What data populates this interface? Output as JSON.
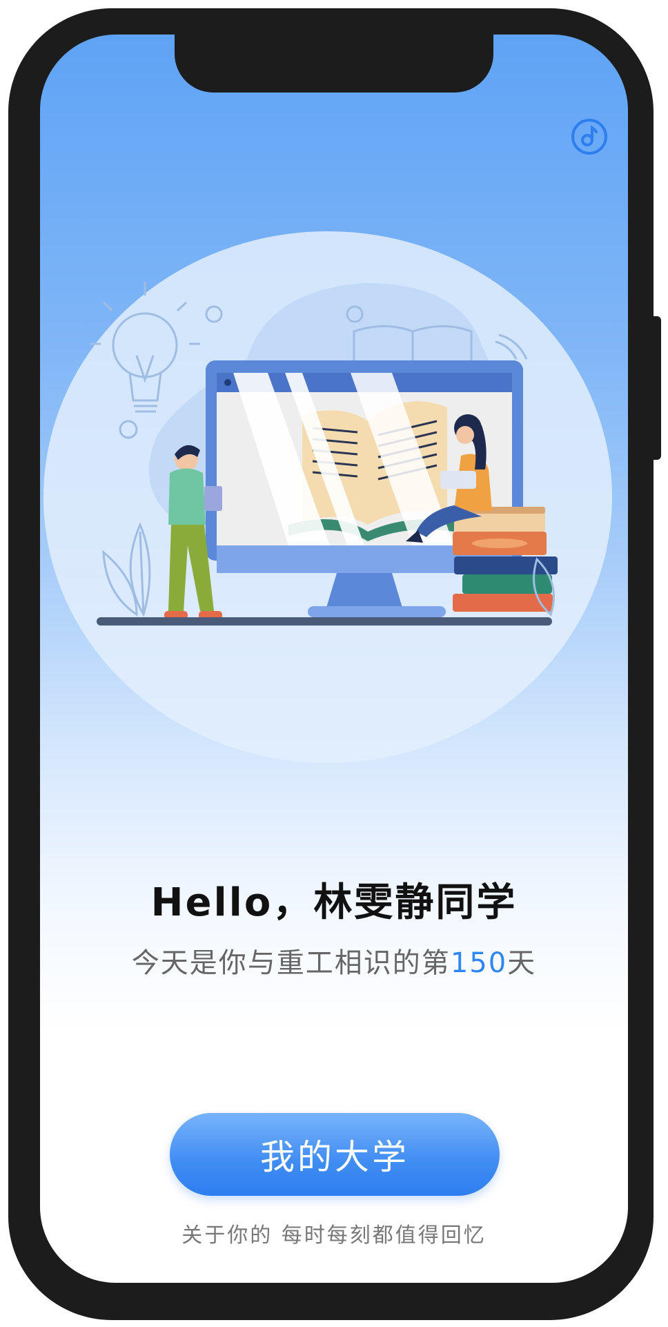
{
  "icons": {
    "music": "music-disc-icon",
    "illustration": "study-illustration"
  },
  "greeting": {
    "prefix": "Hello，",
    "name": "林雯静同学"
  },
  "subtitle": {
    "before": "今天是你与重工相识的第",
    "days": "150",
    "after": "天"
  },
  "primary_button": {
    "label": "我的大学"
  },
  "tagline": "关于你的 每时每刻都值得回忆",
  "colors": {
    "accent": "#2f86f3",
    "gradient_top": "#5fa3f5",
    "button_top": "#78b3fb",
    "button_bottom": "#2f7ef0",
    "frame": "#1c1c1c"
  }
}
